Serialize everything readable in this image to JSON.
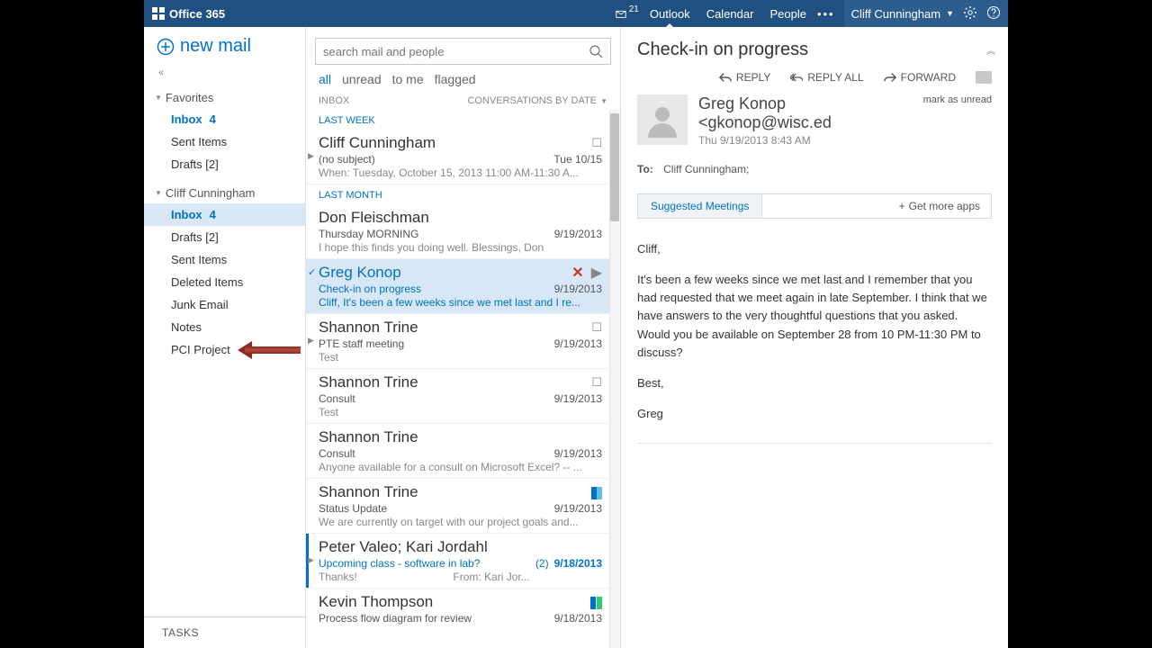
{
  "brand": "Office 365",
  "header": {
    "notification_count": "21",
    "nav": {
      "outlook": "Outlook",
      "calendar": "Calendar",
      "people": "People"
    },
    "user_name": "Cliff Cunningham"
  },
  "sidebar": {
    "new_mail": "new mail",
    "favorites_label": "Favorites",
    "favorites": {
      "inbox": "Inbox",
      "inbox_count": "4",
      "sent": "Sent Items",
      "drafts": "Drafts [2]"
    },
    "account_label": "Cliff Cunningham",
    "account": {
      "inbox": "Inbox",
      "inbox_count": "4",
      "drafts": "Drafts [2]",
      "sent": "Sent Items",
      "deleted": "Deleted Items",
      "junk": "Junk Email",
      "notes": "Notes",
      "pci": "PCI Project"
    },
    "tasks": "TASKS"
  },
  "msglist": {
    "search_placeholder": "search mail and people",
    "filters": {
      "all": "all",
      "unread": "unread",
      "tome": "to me",
      "flagged": "flagged"
    },
    "header_left": "INBOX",
    "header_right": "CONVERSATIONS BY DATE",
    "group_last_week": "LAST WEEK",
    "group_last_month": "LAST MONTH",
    "items": [
      {
        "sender": "Cliff Cunningham",
        "subject": "(no subject)",
        "date": "Tue 10/15",
        "preview": "When: Tuesday, October 15, 2013 11:00 AM-11:30 A...",
        "icon": "calendar"
      },
      {
        "sender": "Don Fleischman",
        "subject": "Thursday MORNING",
        "date": "9/19/2013",
        "preview": "I hope this finds you doing well. Blessings,  Don"
      },
      {
        "sender": "Greg Konop",
        "subject": "Check-in on progress",
        "date": "9/19/2013",
        "preview": "Cliff,   It's been a few weeks since we met last and I re..."
      },
      {
        "sender": "Shannon Trine",
        "subject": "PTE staff meeting",
        "date": "9/19/2013",
        "preview": "Test",
        "icon": "calendar"
      },
      {
        "sender": "Shannon Trine",
        "subject": "Consult",
        "date": "9/19/2013",
        "preview": "Test",
        "icon": "calendar"
      },
      {
        "sender": "Shannon Trine",
        "subject": "Consult",
        "date": "9/19/2013",
        "preview": "Anyone available for a consult on Microsoft Excel? -- ..."
      },
      {
        "sender": "Shannon Trine",
        "subject": "Status Update",
        "date": "9/19/2013",
        "preview": "We are currently on target with our project goals and...",
        "icon": "category"
      },
      {
        "sender": "Peter Valeo; Kari Jordahl",
        "subject": "Upcoming class - software in lab?",
        "count_label": "(2)",
        "date": "9/18/2013",
        "preview": "Thanks!",
        "preview_from": "From: Kari Jor..."
      },
      {
        "sender": "Kevin Thompson",
        "subject": "Process flow diagram for review",
        "date": "9/18/2013",
        "icon": "category2"
      }
    ]
  },
  "reading": {
    "title": "Check-in on progress",
    "actions": {
      "reply": "REPLY",
      "reply_all": "REPLY ALL",
      "forward": "FORWARD"
    },
    "mark_unread": "mark as unread",
    "from_name": "Greg Konop <gkonop@wisc.ed",
    "from_date": "Thu 9/19/2013 8:43 AM",
    "to_label": "To:",
    "to_value": "Cliff Cunningham;",
    "apps_tab": "Suggested Meetings",
    "apps_more": "Get more apps",
    "body": {
      "p1": "Cliff,",
      "p2": "It's been a few weeks since we met last and I remember that you had requested that we meet again in late September.  I think that we have answers to the very thoughtful questions that you asked.  Would you be available on September 28 from 10 PM-11:30 PM to discuss?",
      "p3": "Best,",
      "p4": "Greg"
    }
  }
}
